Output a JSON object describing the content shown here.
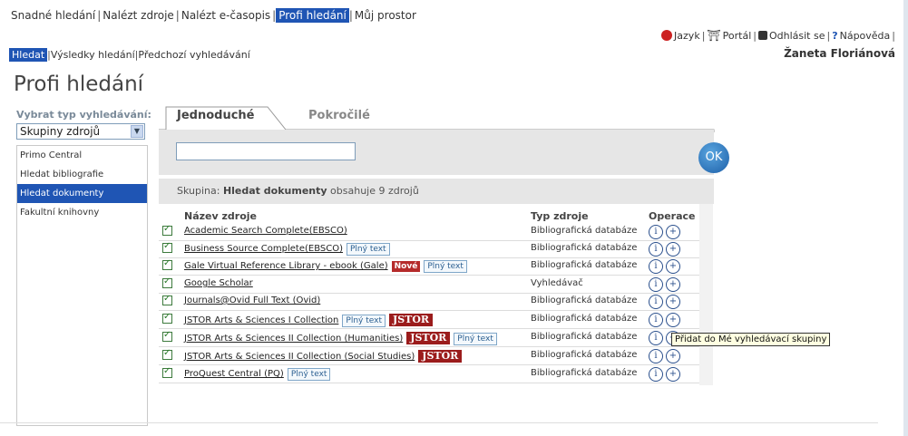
{
  "topnav": {
    "items": [
      "Snadné hledání",
      "Nalézt zdroje",
      "Nalézt e-časopis",
      "Profi hledání",
      "Můj prostor"
    ],
    "active": "Profi hledání"
  },
  "subnav": {
    "items": [
      "Hledat",
      "Výsledky hledání",
      "Předchozí vyhledávání"
    ]
  },
  "utilnav": {
    "language": "Jazyk",
    "portal": "Portál",
    "logout": "Odhlásit se",
    "help": "Nápověda"
  },
  "user": "Žaneta Floriánová",
  "page_title": "Profi hledání",
  "search_type": {
    "label": "Vybrat typ vyhledávání:",
    "selected": "Skupiny zdrojů",
    "list": [
      "Primo Central",
      "Hledat bibliografie",
      "Hledat dokumenty",
      "Fakultní knihovny"
    ],
    "selected_index": 2
  },
  "tabs": [
    "Jednoduché",
    "Pokročilé"
  ],
  "search": {
    "value": "",
    "ok_label": "OK"
  },
  "group": {
    "prefix": "Skupina:",
    "name": "Hledat dokumenty",
    "suffix": "obsahuje 9 zdrojů"
  },
  "columns": {
    "name": "Název zdroje",
    "type": "Typ zdroje",
    "ops": "Operace"
  },
  "rows": [
    {
      "name": "Academic Search Complete(EBSCO)",
      "type": "Bibliografická databáze",
      "badges": []
    },
    {
      "name": "Business Source Complete(EBSCO)",
      "type": "Bibliografická databáze",
      "badges": [
        "Plný text"
      ]
    },
    {
      "name": "Gale Virtual Reference Library - ebook (Gale)",
      "type": "Bibliografická databáze",
      "badges": [
        "Nové",
        "Plný text"
      ]
    },
    {
      "name": "Google Scholar",
      "type": "Vyhledávač",
      "badges": []
    },
    {
      "name": "Journals@Ovid Full Text (Ovid)",
      "type": "Bibliografická databáze",
      "badges": []
    },
    {
      "name": "JSTOR Arts & Sciences I Collection",
      "type": "Bibliografická databáze",
      "badges": [
        "Plný text",
        "JSTOR"
      ]
    },
    {
      "name": "JSTOR Arts & Sciences II Collection (Humanities)",
      "type": "Bibliografická databáze",
      "badges": [
        "JSTOR",
        "Plný text"
      ]
    },
    {
      "name": "JSTOR Arts & Sciences II Collection (Social Studies)",
      "type": "Bibliografická databáze",
      "badges": [
        "JSTOR"
      ]
    },
    {
      "name": "ProQuest Central (PQ)",
      "type": "Bibliografická databáze",
      "badges": [
        "Plný text"
      ]
    }
  ],
  "tooltip": "Přidat do Mé vyhledávací skupiny",
  "icons": {
    "info": "info-icon",
    "add": "add-icon"
  }
}
